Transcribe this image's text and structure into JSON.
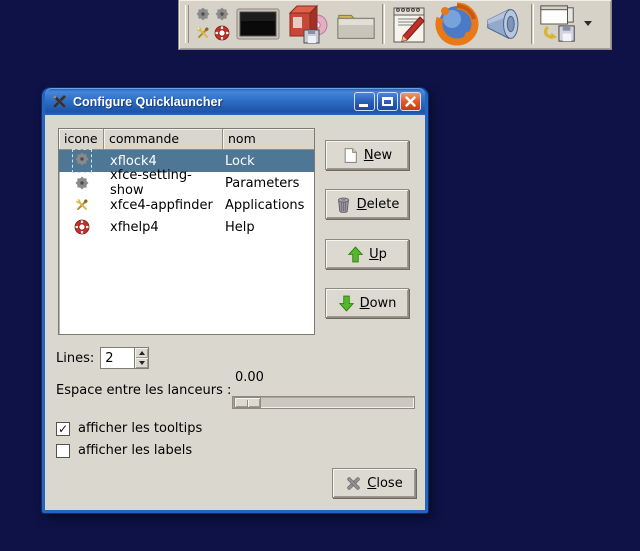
{
  "colors": {
    "desktop_bg": "#0e1246",
    "panel_bg": "#d6d2c8",
    "titlebar_blue": "#2a6ac4",
    "selection_blue": "#4e7795",
    "close_button_red": "#d8431f",
    "arrow_green": "#55b82a"
  },
  "panel": {
    "launcher_icons": [
      "gear-icon",
      "gear-icon",
      "tools-icon",
      "lifering-icon"
    ],
    "items": [
      "terminal",
      "package-manager",
      "file-manager",
      "text-editor",
      "firefox",
      "volume",
      "session-save"
    ],
    "has_dropdown_arrow": true
  },
  "dialog": {
    "title": "Configure Quicklauncher",
    "window_controls": [
      "minimize",
      "maximize",
      "close"
    ],
    "list": {
      "columns": [
        "icone",
        "commande",
        "nom"
      ],
      "rows": [
        {
          "icon": "gear-icon",
          "commande": "xflock4",
          "nom": "Lock",
          "selected": true
        },
        {
          "icon": "gear-icon",
          "commande": "xfce-setting-show",
          "nom": "Parameters",
          "selected": false
        },
        {
          "icon": "tools-icon",
          "commande": "xfce4-appfinder",
          "nom": "Applications",
          "selected": false
        },
        {
          "icon": "lifering-icon",
          "commande": "xfhelp4",
          "nom": "Help",
          "selected": false
        }
      ]
    },
    "buttons": {
      "new": "New",
      "delete": "Delete",
      "up": "Up",
      "down": "Down",
      "close": "Close"
    },
    "lines": {
      "label": "Lines:",
      "value": "2"
    },
    "spacing": {
      "label": "Espace entre les lanceurs :",
      "value": "0.00"
    },
    "checkboxes": [
      {
        "label": "afficher les tooltips",
        "checked": true,
        "glyph": "✓"
      },
      {
        "label": "afficher les labels",
        "checked": false,
        "glyph": ""
      }
    ]
  }
}
